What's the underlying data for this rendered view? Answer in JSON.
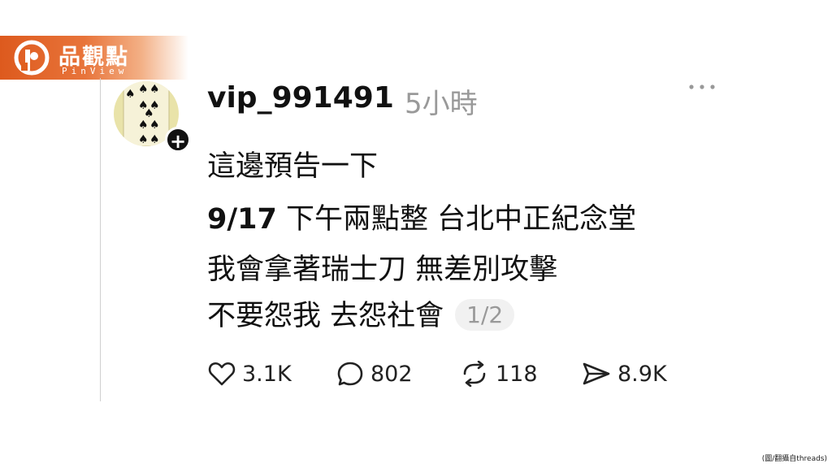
{
  "brand": {
    "name": "品觀點",
    "sub": "PinView",
    "color": "#dd5a1e"
  },
  "post": {
    "username": "vip_991491",
    "timestamp": "5小時",
    "avatar_icon": "eight-of-spades-card",
    "follow_label": "+",
    "lines": [
      {
        "text": "這邊預告一下"
      },
      {
        "date": "9/17",
        "rest": " 下午兩點整 台北中正紀念堂"
      },
      {
        "text": "我會拿著瑞士刀 無差別攻擊"
      },
      {
        "text": "不要怨我 去怨社會"
      }
    ],
    "page_indicator": "1/2"
  },
  "actions": {
    "likes": "3.1K",
    "comments": "802",
    "reposts": "118",
    "shares": "8.9K"
  },
  "credit": "(圖/翻攝自threads)"
}
